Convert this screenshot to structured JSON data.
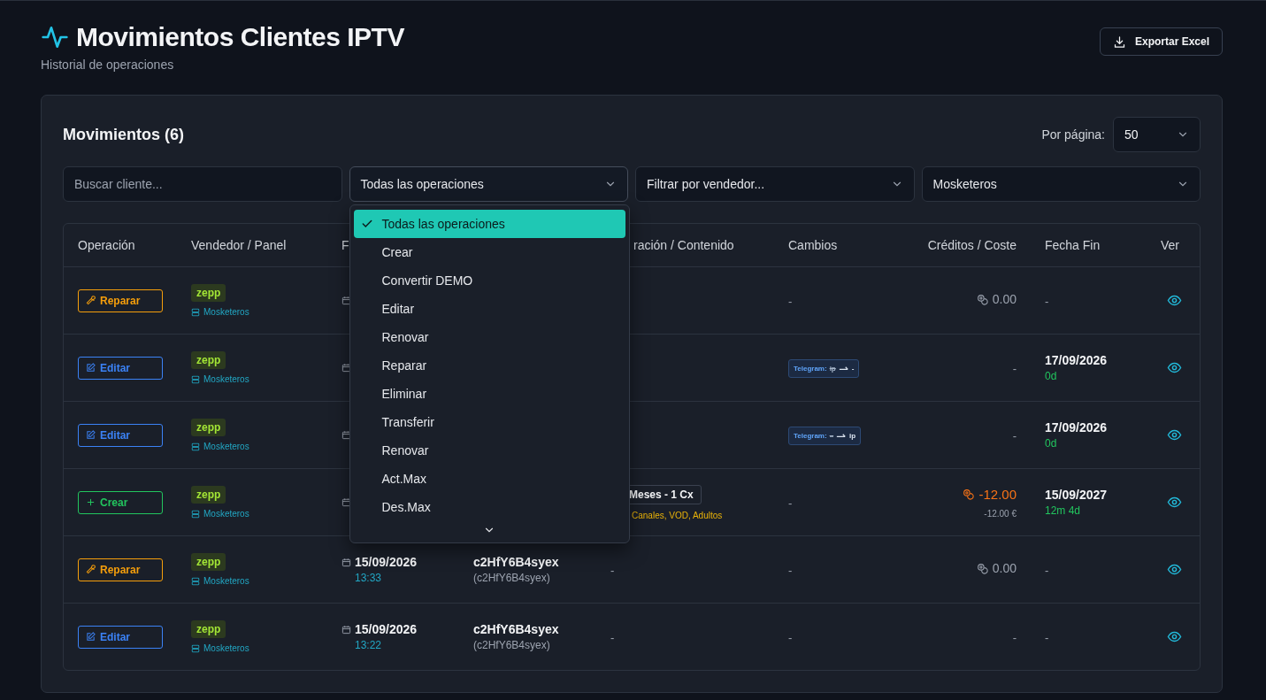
{
  "header": {
    "title": "Movimientos Clientes IPTV",
    "subtitle": "Historial de operaciones",
    "export_button": "Exportar Excel"
  },
  "panel": {
    "title": "Movimientos (6)",
    "per_page_label": "Por página:",
    "per_page": "50"
  },
  "filters": [
    {
      "kind": "search",
      "placeholder": "Buscar cliente..."
    },
    {
      "kind": "select",
      "value": "Todas las operaciones",
      "expanded": true,
      "options": [
        {
          "label": "Todas las operaciones",
          "selected": true
        },
        {
          "label": "Crear",
          "selected": false
        },
        {
          "label": "Convertir DEMO",
          "selected": false
        },
        {
          "label": "Editar",
          "selected": false
        },
        {
          "label": "Renovar",
          "selected": false
        },
        {
          "label": "Reparar",
          "selected": false
        },
        {
          "label": "Eliminar",
          "selected": false
        },
        {
          "label": "Transferir",
          "selected": false
        },
        {
          "label": "Renovar",
          "selected": false
        },
        {
          "label": "Act.Max",
          "selected": false
        },
        {
          "label": "Des.Max",
          "selected": false
        }
      ]
    },
    {
      "kind": "select",
      "value": "Filtrar por vendedor...",
      "expanded": false
    },
    {
      "kind": "select",
      "value": "Mosketeros",
      "expanded": false
    }
  ],
  "table": {
    "columns": [
      {
        "kind": "operation",
        "label": "Operación"
      },
      {
        "kind": "vendor",
        "label": "Vendedor / Panel"
      },
      {
        "kind": "date",
        "label": "F"
      },
      {
        "kind": "duration",
        "label": "ración / Contenido"
      },
      {
        "kind": "changes",
        "label": "Cambios"
      },
      {
        "kind": "credits",
        "label": "Créditos / Coste"
      },
      {
        "kind": "end",
        "label": "Fecha Fin"
      },
      {
        "kind": "view",
        "label": "Ver"
      }
    ],
    "rows": [
      {
        "operation": {
          "kind": "reparar",
          "label": "Reparar"
        },
        "vendor": "zepp",
        "panel": "Mosketeros",
        "changes": {
          "kind": "plain",
          "text": "-"
        },
        "credits": {
          "kind": "coins",
          "text": "0.00"
        },
        "end": {
          "date": "-"
        }
      },
      {
        "operation": {
          "kind": "editar",
          "label": "Editar"
        },
        "vendor": "zepp",
        "panel": "Mosketeros",
        "changes": {
          "kind": "telegram",
          "field": "Telegram:",
          "from": "ip",
          "to": "-"
        },
        "credits": {
          "kind": "plain",
          "text": "-"
        },
        "end": {
          "date": "17/09/2026",
          "remaining": "0d"
        }
      },
      {
        "operation": {
          "kind": "editar",
          "label": "Editar"
        },
        "vendor": "zepp",
        "panel": "Mosketeros",
        "changes": {
          "kind": "telegram",
          "field": "Telegram:",
          "from": "–",
          "to": "ip"
        },
        "credits": {
          "kind": "plain",
          "text": "-"
        },
        "end": {
          "date": "17/09/2026",
          "remaining": "0d"
        }
      },
      {
        "operation": {
          "kind": "crear",
          "label": "Crear"
        },
        "vendor": "zepp",
        "panel": "Mosketeros",
        "duration": {
          "badge": "Meses - 1 Cx",
          "sub": "Canales, VOD, Adultos"
        },
        "changes": {
          "kind": "plain",
          "text": "-"
        },
        "credits": {
          "kind": "debit",
          "text": "-12.00",
          "sub": "-12.00 €"
        },
        "end": {
          "date": "15/09/2027",
          "remaining": "12m 4d"
        }
      },
      {
        "operation": {
          "kind": "reparar",
          "label": "Reparar"
        },
        "vendor": "zepp",
        "panel": "Mosketeros",
        "date": "15/09/2026",
        "time": "13:33",
        "client": "c2HfY6B4syex",
        "client_sub": "(c2HfY6B4syex)",
        "duration": {
          "text": "-"
        },
        "changes": {
          "kind": "plain",
          "text": "-"
        },
        "credits": {
          "kind": "coins",
          "text": "0.00"
        },
        "end": {
          "date": "-"
        }
      },
      {
        "operation": {
          "kind": "editar",
          "label": "Editar"
        },
        "vendor": "zepp",
        "panel": "Mosketeros",
        "date": "15/09/2026",
        "time": "13:22",
        "client": "c2HfY6B4syex",
        "client_sub": "(c2HfY6B4syex)",
        "duration": {
          "text": "-"
        },
        "changes": {
          "kind": "plain",
          "text": "-"
        },
        "credits": {
          "kind": "plain",
          "text": "-"
        },
        "end": {
          "date": "-"
        }
      }
    ]
  }
}
